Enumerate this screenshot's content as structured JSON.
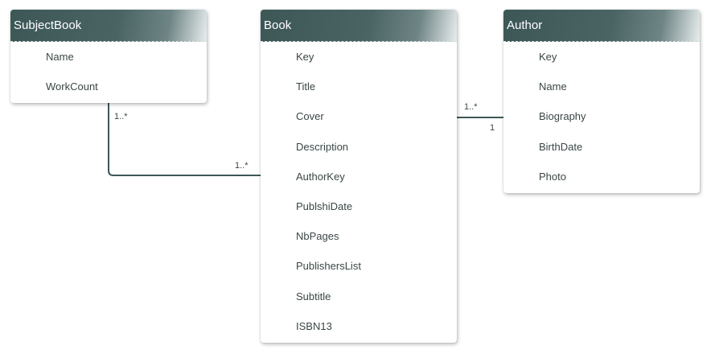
{
  "entities": {
    "subjectbook": {
      "title": "SubjectBook",
      "fields": [
        "Name",
        "WorkCount"
      ]
    },
    "book": {
      "title": "Book",
      "fields": [
        "Key",
        "Title",
        "Cover",
        "Description",
        "AuthorKey",
        "PublshiDate",
        "NbPages",
        "PublishersList",
        "Subtitle",
        "ISBN13"
      ]
    },
    "author": {
      "title": "Author",
      "fields": [
        "Key",
        "Name",
        "Biography",
        "BirthDate",
        "Photo"
      ]
    }
  },
  "relations": {
    "subjectbook_book": {
      "source_multiplicity": "1..*",
      "target_multiplicity": "1..*"
    },
    "book_author": {
      "source_multiplicity": "1..*",
      "target_multiplicity": "1"
    }
  },
  "colors": {
    "header": "#3d5757",
    "connector": "#3d5757",
    "text": "#3b4646"
  }
}
